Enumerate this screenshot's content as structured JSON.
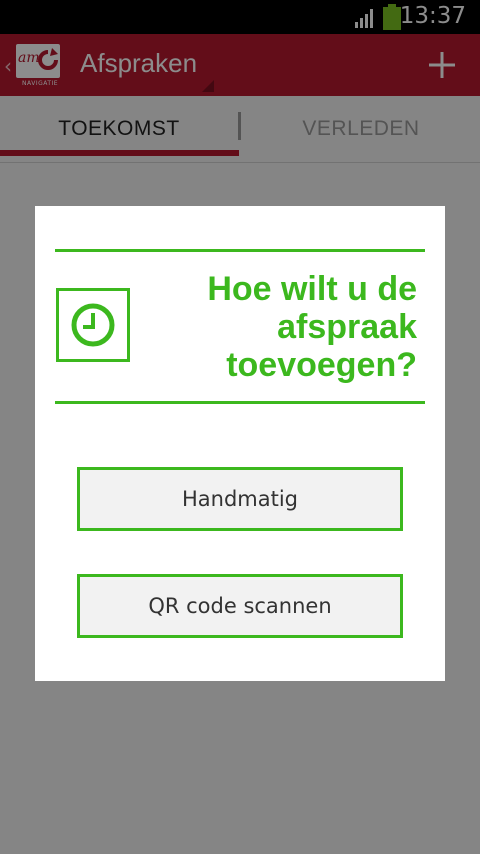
{
  "status_bar": {
    "time": "13:37",
    "signal_icon": "signal-bars-icon",
    "battery_icon": "battery-icon",
    "battery_color": "#7bc122"
  },
  "action_bar": {
    "title": "Afspraken",
    "logo_text": "am",
    "logo_subtext": "NAVIGATIE",
    "add_icon": "plus-icon",
    "color": "#b5192f"
  },
  "tabs": [
    {
      "label": "TOEKOMST",
      "selected": true
    },
    {
      "label": "VERLEDEN",
      "selected": false
    }
  ],
  "dialog": {
    "heading_lines": [
      "Hoe wilt u de",
      "afspraak",
      "toevoegen?"
    ],
    "icon": "clock-icon",
    "accent_color": "#3cb81e",
    "buttons": {
      "manual": "Handmatig",
      "qr": "QR code scannen"
    }
  }
}
